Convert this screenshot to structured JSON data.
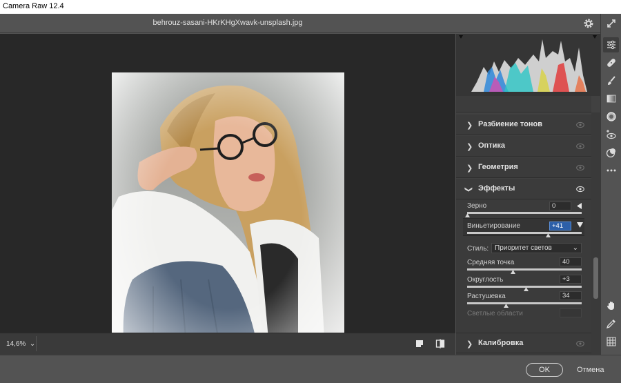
{
  "app": {
    "title": "Camera Raw 12.4"
  },
  "file": {
    "name": "behrouz-sasani-HKrKHgXwavk-unsplash.jpg"
  },
  "view": {
    "zoom": "14,6%"
  },
  "panels": {
    "sections": [
      {
        "label": "Разбиение тонов"
      },
      {
        "label": "Оптика"
      },
      {
        "label": "Геометрия"
      }
    ],
    "effects": {
      "label": "Эффекты",
      "grain": {
        "label": "Зерно",
        "value": "0",
        "fraction": 0.0
      },
      "vignette": {
        "label": "Виньетирование",
        "value": "+41",
        "fraction": 0.705
      },
      "style": {
        "label": "Стиль:",
        "selected": "Приоритет светов"
      },
      "midpoint": {
        "label": "Средняя точка",
        "value": "40",
        "fraction": 0.4
      },
      "roundness": {
        "label": "Округлость",
        "value": "+3",
        "fraction": 0.515
      },
      "feather": {
        "label": "Растушевка",
        "value": "34",
        "fraction": 0.34
      },
      "highlights": {
        "label": "Светлые области",
        "value": ""
      }
    },
    "calibration": {
      "label": "Калибровка"
    }
  },
  "footer": {
    "ok": "OK",
    "cancel": "Отмена"
  },
  "colors": {
    "accent_value": "#2c5fa8",
    "panel": "#3b3b3b",
    "canvas": "#282828"
  }
}
